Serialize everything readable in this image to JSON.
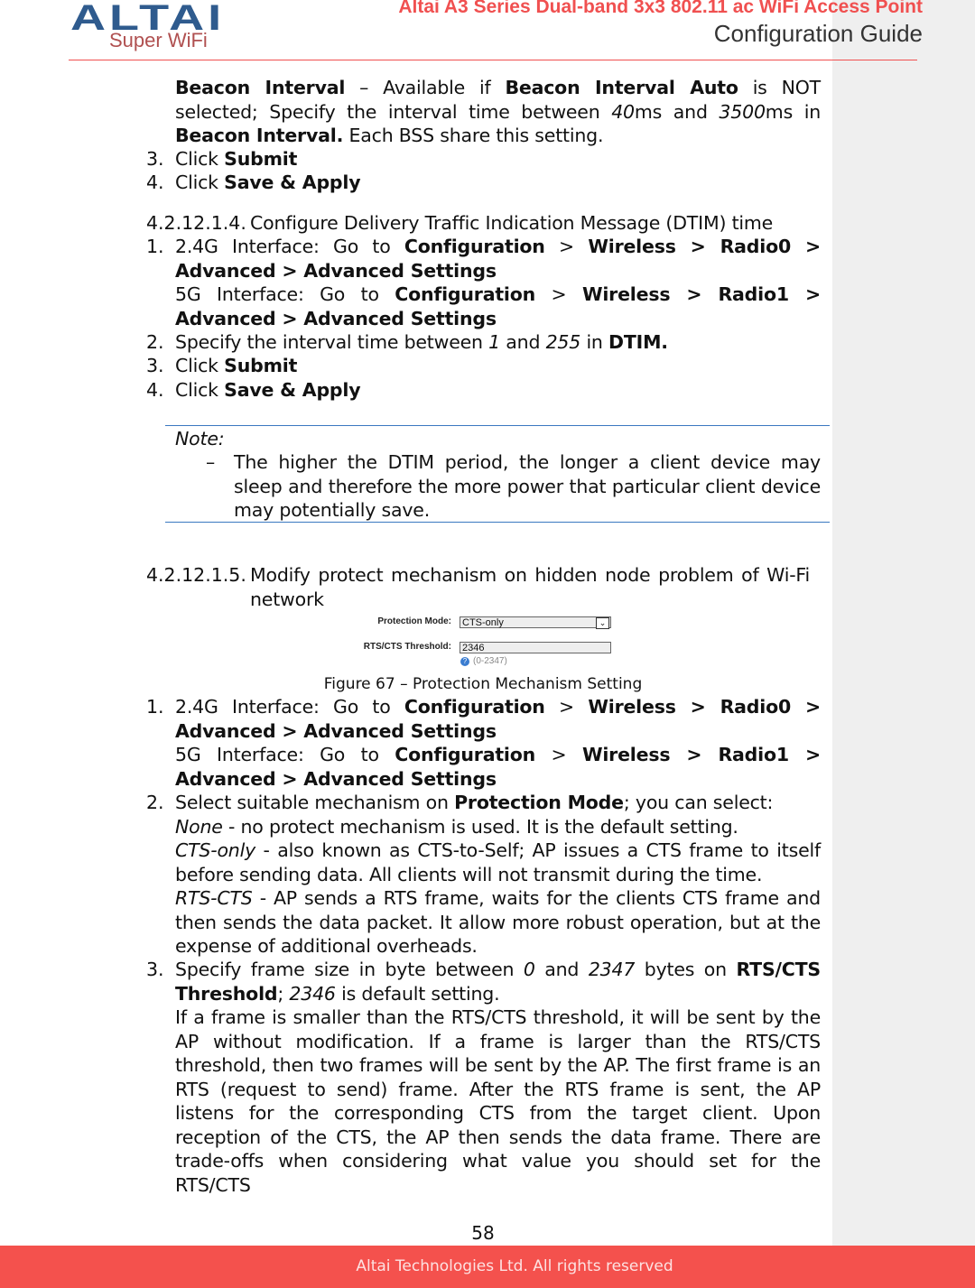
{
  "header": {
    "logo_text": "ALTAI",
    "logo_sub": "Super WiFi",
    "title": "Altai A3 Series Dual-band 3x3 802.11 ac WiFi Access Point",
    "subtitle": "Configuration Guide"
  },
  "colors": {
    "accent": "#f05050",
    "brand_blue": "#2f5b8e",
    "note_rule": "#3a78c0"
  },
  "blocks": [
    {
      "id": "beacon-interval-desc",
      "runs": [
        {
          "t": "Beacon Interval",
          "b": 1
        },
        {
          "t": " – Available if "
        },
        {
          "t": "Beacon Interval Auto",
          "b": 1
        },
        {
          "t": " is NOT selected; Specify the interval time between "
        },
        {
          "t": "40",
          "i": 1
        },
        {
          "t": "ms and "
        },
        {
          "t": "3500",
          "i": 1
        },
        {
          "t": "ms in "
        },
        {
          "t": "Beacon Interval.",
          "b": 1
        },
        {
          "t": " Each BSS share this setting."
        }
      ]
    },
    {
      "id": "step-3a",
      "num": "3.",
      "runs": [
        {
          "t": "Click "
        },
        {
          "t": "Submit",
          "b": 1
        }
      ]
    },
    {
      "id": "step-4a",
      "num": "4.",
      "runs": [
        {
          "t": "Click "
        },
        {
          "t": "Save & Apply",
          "b": 1
        }
      ]
    },
    {
      "id": "heading-dtim",
      "num": "4.2.12.1.4.",
      "runs": [
        {
          "t": "Configure Delivery Traffic Indication Message (DTIM) time"
        }
      ]
    },
    {
      "id": "dtim-step-1",
      "num": "1.",
      "runs": [
        {
          "t": "2.4G Interface: Go to "
        },
        {
          "t": "Configuration",
          "b": 1
        },
        {
          "t": " > "
        },
        {
          "t": "Wireless > Radio0 > Advanced > Advanced Settings",
          "b": 1
        }
      ]
    },
    {
      "id": "dtim-step-1-5g",
      "runs": [
        {
          "t": "5G Interface: Go to "
        },
        {
          "t": "Configuration",
          "b": 1
        },
        {
          "t": " > "
        },
        {
          "t": "Wireless > Radio1 > Advanced > Advanced Settings",
          "b": 1
        }
      ]
    },
    {
      "id": "dtim-step-2",
      "num": "2.",
      "runs": [
        {
          "t": "Specify the interval time between "
        },
        {
          "t": "1",
          "i": 1
        },
        {
          "t": " and "
        },
        {
          "t": "255",
          "i": 1
        },
        {
          "t": " in "
        },
        {
          "t": "DTIM.",
          "b": 1
        }
      ]
    },
    {
      "id": "dtim-step-3",
      "num": "3.",
      "runs": [
        {
          "t": "Click "
        },
        {
          "t": "Submit",
          "b": 1
        }
      ]
    },
    {
      "id": "dtim-step-4",
      "num": "4.",
      "runs": [
        {
          "t": "Click "
        },
        {
          "t": "Save & Apply",
          "b": 1
        }
      ]
    },
    {
      "id": "note-label",
      "runs": [
        {
          "t": "Note:",
          "i": 1
        }
      ]
    },
    {
      "id": "note-text",
      "num": "–",
      "runs": [
        {
          "t": "The higher the DTIM period, the longer a client device may sleep and therefore the more power that particular client device may potentially save."
        }
      ]
    },
    {
      "id": "heading-protect",
      "num": "4.2.12.1.5.",
      "runs": [
        {
          "t": "Modify protect mechanism on hidden node problem of Wi-Fi network"
        }
      ]
    },
    {
      "id": "prot-step-1",
      "num": "1.",
      "runs": [
        {
          "t": "2.4G Interface: Go to "
        },
        {
          "t": "Configuration",
          "b": 1
        },
        {
          "t": " > "
        },
        {
          "t": "Wireless > Radio0 > Advanced > Advanced Settings",
          "b": 1
        }
      ]
    },
    {
      "id": "prot-step-1-5g",
      "runs": [
        {
          "t": "5G Interface: Go to "
        },
        {
          "t": "Configuration",
          "b": 1
        },
        {
          "t": " > "
        },
        {
          "t": "Wireless > Radio1 > Advanced > Advanced Settings",
          "b": 1
        }
      ]
    },
    {
      "id": "prot-step-2",
      "num": "2.",
      "runs": [
        {
          "t": "Select suitable mechanism on "
        },
        {
          "t": "Protection Mode",
          "b": 1
        },
        {
          "t": "; you can select:"
        }
      ]
    },
    {
      "id": "opt-none",
      "runs": [
        {
          "t": "None",
          "i": 1
        },
        {
          "t": " - no protect mechanism is used. It is the default setting."
        }
      ]
    },
    {
      "id": "opt-cts",
      "runs": [
        {
          "t": "CTS-only",
          "i": 1
        },
        {
          "t": " - also known as CTS-to-Self; AP issues a CTS frame to itself before sending data. All clients will not transmit during the time."
        }
      ]
    },
    {
      "id": "opt-rts",
      "runs": [
        {
          "t": "RTS-CTS",
          "i": 1
        },
        {
          "t": " - AP sends a RTS frame, waits for the clients CTS frame and then sends the data packet. It allow more robust operation, but at the expense of additional overheads."
        }
      ]
    },
    {
      "id": "prot-step-3",
      "num": "3.",
      "runs": [
        {
          "t": "Specify frame size in byte between "
        },
        {
          "t": "0",
          "i": 1
        },
        {
          "t": " and "
        },
        {
          "t": "2347",
          "i": 1
        },
        {
          "t": " bytes on "
        },
        {
          "t": "RTS/CTS Threshold",
          "b": 1
        },
        {
          "t": "; "
        },
        {
          "t": "2346",
          "i": 1
        },
        {
          "t": " is default setting."
        }
      ]
    },
    {
      "id": "rts-explain",
      "runs": [
        {
          "t": "If a frame is smaller than the RTS/CTS threshold, it will be sent by the AP without modification. If a frame is larger than the RTS/CTS threshold, then two frames will be sent by the AP. The first frame is an RTS (request to send) frame. After the RTS frame is sent, the AP listens for the corresponding CTS from the target client. Upon reception of the CTS, the AP then sends the data frame. There are trade-offs when considering what value you should set for the RTS/CTS"
        }
      ]
    }
  ],
  "figure": {
    "protection_mode_label": "Protection Mode:",
    "protection_mode_value": "CTS-only",
    "rts_label": "RTS/CTS Threshold:",
    "rts_value": "2346",
    "rts_hint": "(0-2347)",
    "caption": "Figure 67 – Protection Mechanism Setting"
  },
  "page_number": "58",
  "footer": "Altai Technologies Ltd. All rights reserved"
}
